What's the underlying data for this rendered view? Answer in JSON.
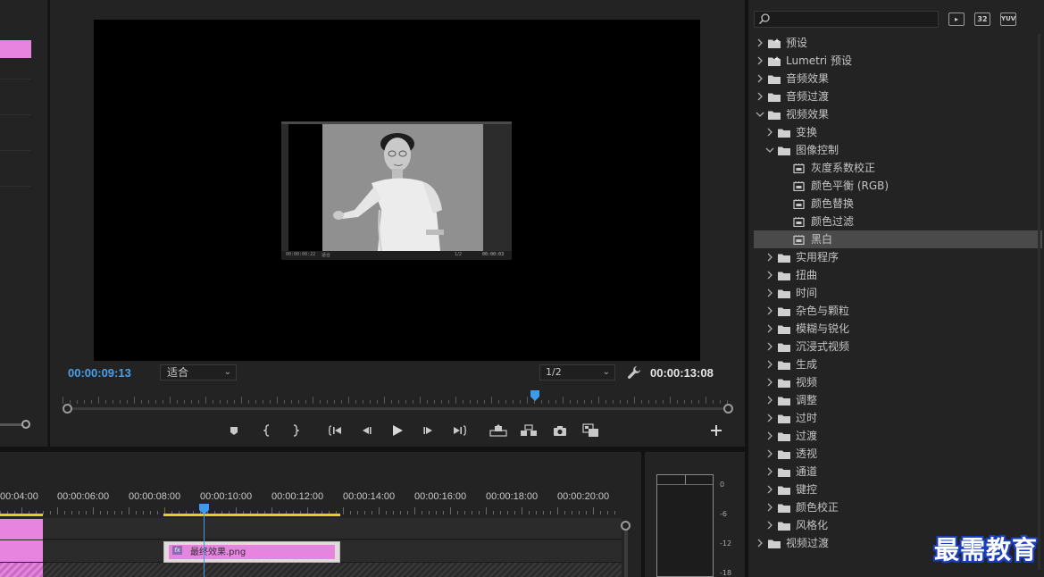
{
  "monitor": {
    "timecode_current": "00:00:09:13",
    "fit_select": "适合",
    "ratio_select": "1/2",
    "timecode_duration": "00:00:13:08",
    "playhead_fraction": 0.71,
    "nested_preview": {
      "timecode": "00:00:00:22",
      "fit": "适合",
      "ratio": "1/2",
      "timecode_right": "00:00:03"
    }
  },
  "transport": {
    "buttons": [
      "marker-icon",
      "mark-in-icon",
      "mark-out-icon",
      "go-to-in-icon",
      "step-back-icon",
      "play-icon",
      "step-forward-icon",
      "go-to-out-icon",
      "lift-icon",
      "extract-icon",
      "export-frame-icon",
      "comparison-view-icon",
      "add-button-icon"
    ]
  },
  "effects": {
    "search_placeholder": "",
    "badges": [
      "32",
      "YUV"
    ],
    "tree": [
      {
        "label": "预设",
        "level": 0,
        "expanded": false,
        "icon": "preset-folder-icon"
      },
      {
        "label": "Lumetri 预设",
        "level": 0,
        "expanded": false,
        "icon": "preset-folder-icon"
      },
      {
        "label": "音频效果",
        "level": 0,
        "expanded": false,
        "icon": "folder-icon"
      },
      {
        "label": "音频过渡",
        "level": 0,
        "expanded": false,
        "icon": "folder-icon"
      },
      {
        "label": "视频效果",
        "level": 0,
        "expanded": true,
        "icon": "folder-icon"
      },
      {
        "label": "变换",
        "level": 1,
        "expanded": false,
        "icon": "folder-icon"
      },
      {
        "label": "图像控制",
        "level": 1,
        "expanded": true,
        "icon": "folder-icon"
      },
      {
        "label": "灰度系数校正",
        "level": 2,
        "icon": "effect-icon"
      },
      {
        "label": "颜色平衡 (RGB)",
        "level": 2,
        "icon": "effect-icon"
      },
      {
        "label": "颜色替换",
        "level": 2,
        "icon": "effect-icon"
      },
      {
        "label": "颜色过滤",
        "level": 2,
        "icon": "effect-icon"
      },
      {
        "label": "黑白",
        "level": 2,
        "icon": "effect-icon",
        "selected": true
      },
      {
        "label": "实用程序",
        "level": 1,
        "expanded": false,
        "icon": "folder-icon"
      },
      {
        "label": "扭曲",
        "level": 1,
        "expanded": false,
        "icon": "folder-icon"
      },
      {
        "label": "时间",
        "level": 1,
        "expanded": false,
        "icon": "folder-icon"
      },
      {
        "label": "杂色与颗粒",
        "level": 1,
        "expanded": false,
        "icon": "folder-icon"
      },
      {
        "label": "模糊与锐化",
        "level": 1,
        "expanded": false,
        "icon": "folder-icon"
      },
      {
        "label": "沉浸式视频",
        "level": 1,
        "expanded": false,
        "icon": "folder-icon"
      },
      {
        "label": "生成",
        "level": 1,
        "expanded": false,
        "icon": "folder-icon"
      },
      {
        "label": "视频",
        "level": 1,
        "expanded": false,
        "icon": "folder-icon"
      },
      {
        "label": "调整",
        "level": 1,
        "expanded": false,
        "icon": "folder-icon"
      },
      {
        "label": "过时",
        "level": 1,
        "expanded": false,
        "icon": "folder-icon"
      },
      {
        "label": "过渡",
        "level": 1,
        "expanded": false,
        "icon": "folder-icon"
      },
      {
        "label": "透视",
        "level": 1,
        "expanded": false,
        "icon": "folder-icon"
      },
      {
        "label": "通道",
        "level": 1,
        "expanded": false,
        "icon": "folder-icon"
      },
      {
        "label": "键控",
        "level": 1,
        "expanded": false,
        "icon": "folder-icon"
      },
      {
        "label": "颜色校正",
        "level": 1,
        "expanded": false,
        "icon": "folder-icon"
      },
      {
        "label": "风格化",
        "level": 1,
        "expanded": false,
        "icon": "folder-icon"
      },
      {
        "label": "视频过渡",
        "level": 0,
        "expanded": false,
        "icon": "folder-icon"
      }
    ]
  },
  "timeline": {
    "times": [
      "00:04:00",
      "00:00:06:00",
      "00:00:08:00",
      "00:00:10:00",
      "00:00:12:00",
      "00:00:14:00",
      "00:00:16:00",
      "00:00:18:00",
      "00:00:20:00"
    ],
    "clip_name": "最终效果.png",
    "clip_fx": "fx"
  },
  "meter": {
    "db_labels": [
      "0",
      "-6",
      "-12",
      "-18"
    ]
  },
  "watermark": "最需教育",
  "colors": {
    "accent_blue": "#4aa0e8",
    "clip_pink": "#e684e0",
    "work_area_yellow": "#e2d21a"
  }
}
